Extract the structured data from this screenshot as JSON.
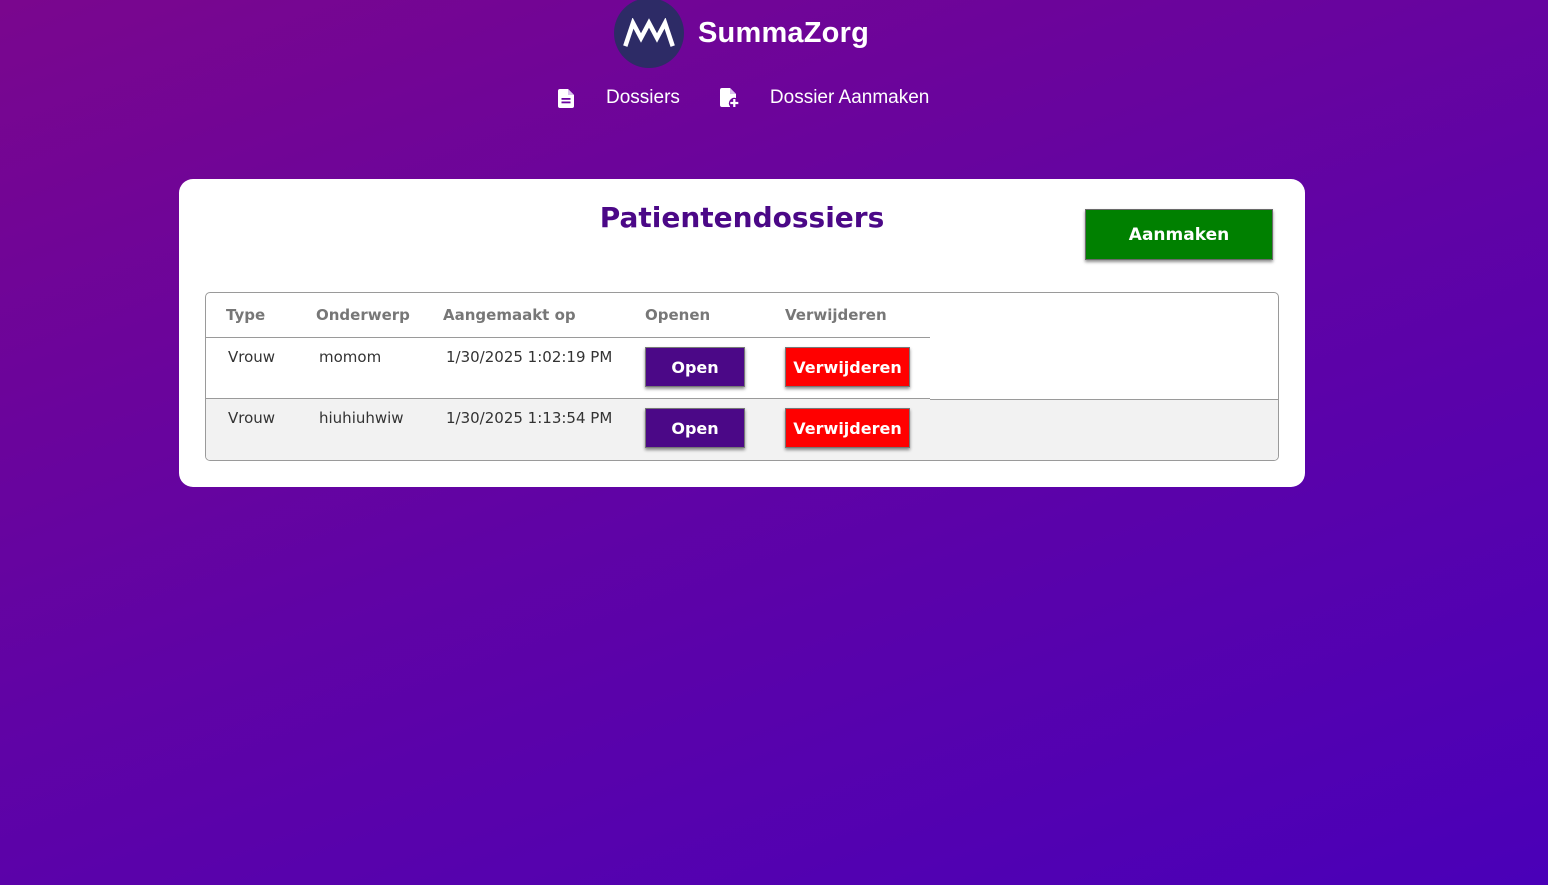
{
  "app": {
    "logo_text": "MM",
    "name": "SummaZorg"
  },
  "nav": {
    "items": [
      {
        "label": "Dossiers",
        "icon": "file-text-icon"
      },
      {
        "label": "Dossier Aanmaken",
        "icon": "file-plus-icon"
      }
    ]
  },
  "page": {
    "title": "Patientendossiers",
    "create_label": "Aanmaken"
  },
  "table": {
    "headers": [
      "Type",
      "Onderwerp",
      "Aangemaakt op",
      "Openen",
      "Verwijderen"
    ],
    "rows": [
      {
        "type": "Vrouw",
        "subject": "momom",
        "created": "1/30/2025 1:02:19 PM",
        "open_label": "Open",
        "delete_label": "Verwijderen"
      },
      {
        "type": "Vrouw",
        "subject": "hiuhiuhwiw",
        "created": "1/30/2025 1:13:54 PM",
        "open_label": "Open",
        "delete_label": "Verwijderen"
      }
    ]
  },
  "colors": {
    "accent_purple": "#4b0887",
    "create_green": "#008000",
    "delete_red": "#ff0000",
    "logo_bg": "#2d2b66"
  }
}
